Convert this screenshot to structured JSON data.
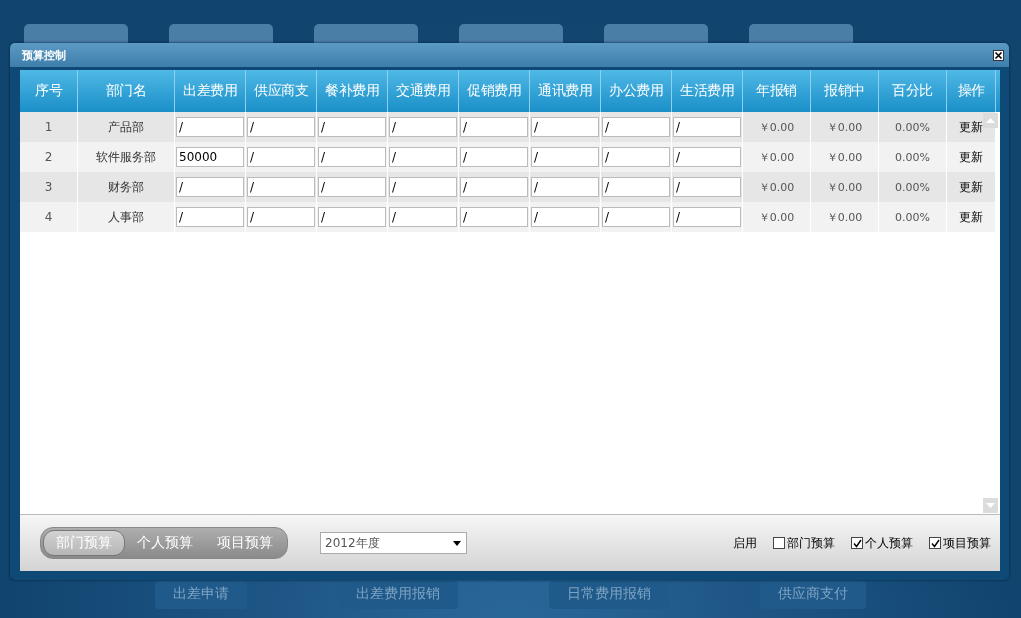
{
  "desktop": {
    "bottom_tiles": [
      "出差申请",
      "出差费用报销",
      "日常费用报销",
      "供应商支付"
    ]
  },
  "window": {
    "title": "预算控制"
  },
  "table": {
    "columns": [
      "序号",
      "部门名",
      "出差费用",
      "供应商支",
      "餐补费用",
      "交通费用",
      "促销费用",
      "通讯费用",
      "办公费用",
      "生活费用",
      "年报销",
      "报销中",
      "百分比",
      "操作"
    ],
    "rows": [
      {
        "index": "1",
        "department": "产品部",
        "costs": [
          "/",
          "/",
          "/",
          "/",
          "/",
          "/",
          "/",
          "/"
        ],
        "annual": "￥0.00",
        "pending": "￥0.00",
        "percent": "0.00%",
        "action": "更新"
      },
      {
        "index": "2",
        "department": "软件服务部",
        "costs": [
          "50000",
          "/",
          "/",
          "/",
          "/",
          "/",
          "/",
          "/"
        ],
        "annual": "￥0.00",
        "pending": "￥0.00",
        "percent": "0.00%",
        "action": "更新"
      },
      {
        "index": "3",
        "department": "财务部",
        "costs": [
          "/",
          "/",
          "/",
          "/",
          "/",
          "/",
          "/",
          "/"
        ],
        "annual": "￥0.00",
        "pending": "￥0.00",
        "percent": "0.00%",
        "action": "更新"
      },
      {
        "index": "4",
        "department": "人事部",
        "costs": [
          "/",
          "/",
          "/",
          "/",
          "/",
          "/",
          "/",
          "/"
        ],
        "annual": "￥0.00",
        "pending": "￥0.00",
        "percent": "0.00%",
        "action": "更新"
      }
    ]
  },
  "footer": {
    "tabs": [
      {
        "label": "部门预算",
        "selected": true
      },
      {
        "label": "个人预算",
        "selected": false
      },
      {
        "label": "项目预算",
        "selected": false
      }
    ],
    "year_select": {
      "value": "2012年度"
    },
    "enable_label": "启用",
    "checkboxes": [
      {
        "label": "部门预算",
        "checked": false
      },
      {
        "label": "个人预算",
        "checked": true
      },
      {
        "label": "项目预算",
        "checked": true
      }
    ]
  }
}
